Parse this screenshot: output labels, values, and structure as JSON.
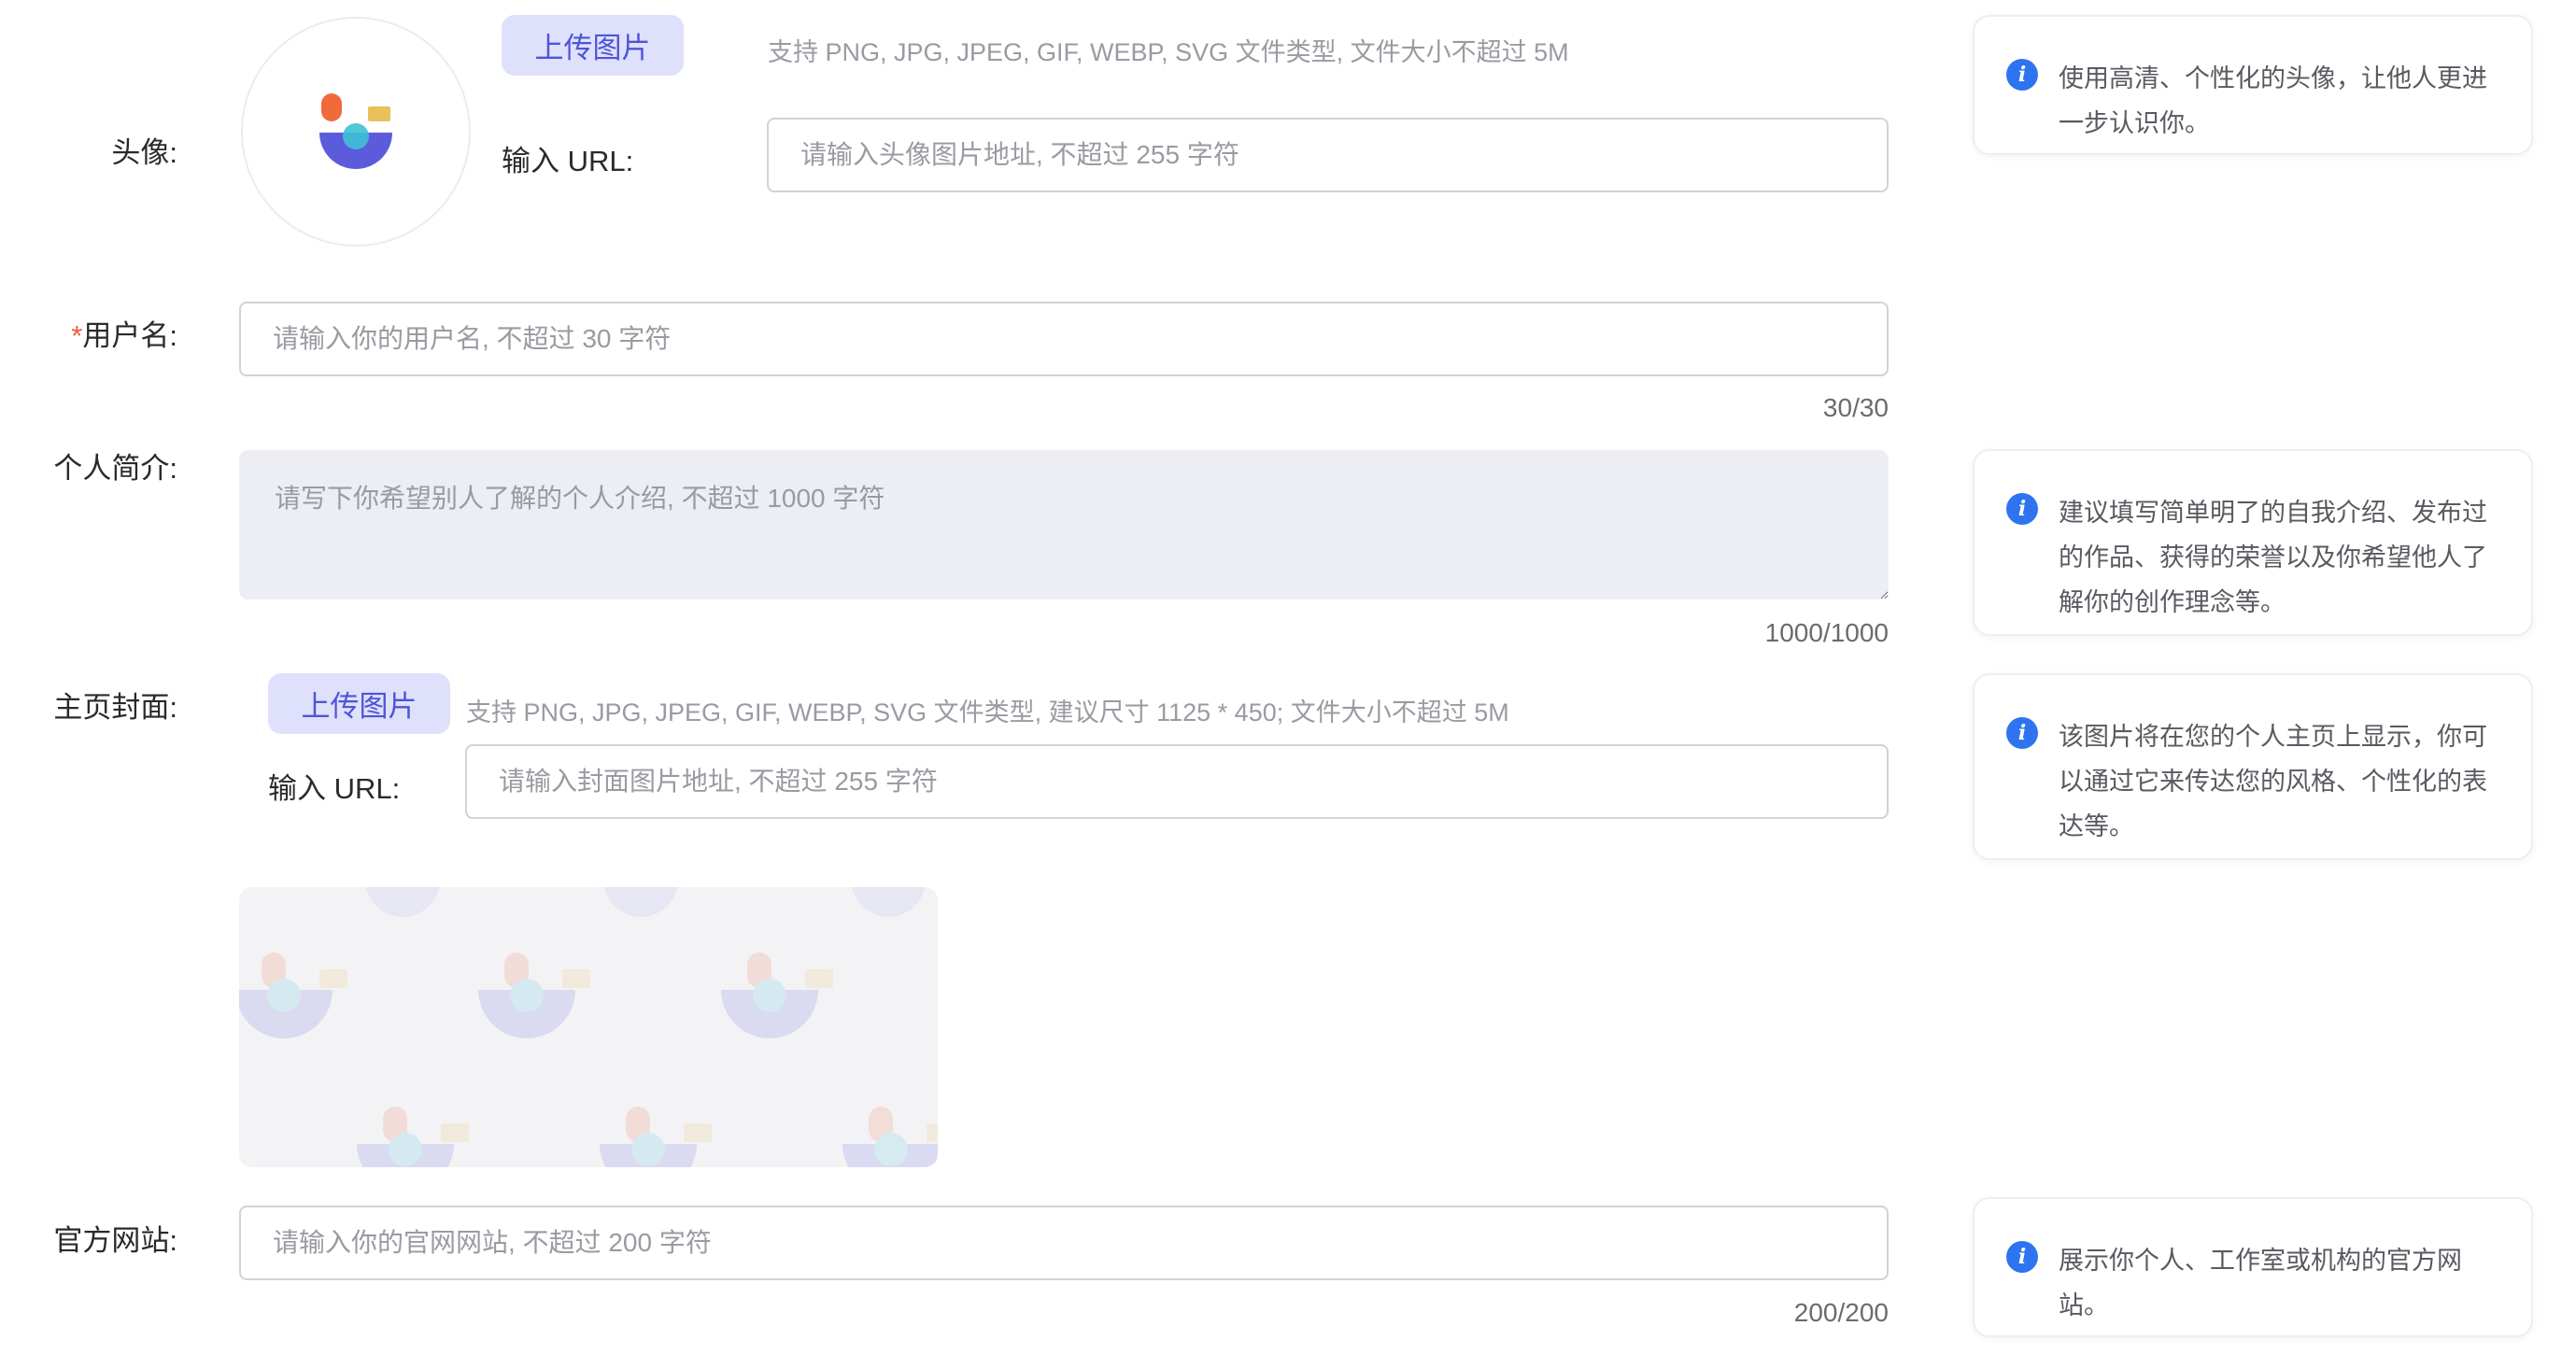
{
  "avatar": {
    "label": "头像:",
    "upload_button": "上传图片",
    "hint": "支持 PNG, JPG, JPEG, GIF, WEBP, SVG 文件类型, 文件大小不超过 5M",
    "url_label": "输入 URL:",
    "url_placeholder": "请输入头像图片地址, 不超过 255 字符",
    "tip": "使用高清、个性化的头像，让他人更进一步认识你。"
  },
  "username": {
    "required_mark": "*",
    "label": "用户名:",
    "placeholder": "请输入你的用户名, 不超过 30 字符",
    "counter": "30/30"
  },
  "bio": {
    "label": "个人简介:",
    "placeholder": "请写下你希望别人了解的个人介绍, 不超过 1000 字符",
    "counter": "1000/1000",
    "tip": "建议填写简单明了的自我介绍、发布过的作品、获得的荣誉以及你希望他人了解你的创作理念等。"
  },
  "cover": {
    "label": "主页封面:",
    "upload_button": "上传图片",
    "hint": "支持 PNG, JPG, JPEG, GIF, WEBP, SVG 文件类型, 建议尺寸 1125 * 450; 文件大小不超过 5M",
    "url_label": "输入 URL:",
    "url_placeholder": "请输入封面图片地址, 不超过 255 字符",
    "tip": "该图片将在您的个人主页上显示，你可以通过它来传达您的风格、个性化的表达等。"
  },
  "website": {
    "label": "官方网站:",
    "placeholder": "请输入你的官网网站, 不超过 200 字符",
    "counter": "200/200",
    "tip": "展示你个人、工作室或机构的官方网站。"
  },
  "icons": {
    "avatar_logo": "default-avatar-logo",
    "info": "info-icon"
  },
  "colors": {
    "accent": "#4d55d6",
    "upload_button_bg": "#dfe0fb",
    "required": "#ef5a3c",
    "info": "#2e74f0",
    "logo_orange": "#f06a3a",
    "logo_yellow": "#e8c15a",
    "logo_purple": "#5b5bdc",
    "logo_cyan": "#3fc1d4"
  }
}
